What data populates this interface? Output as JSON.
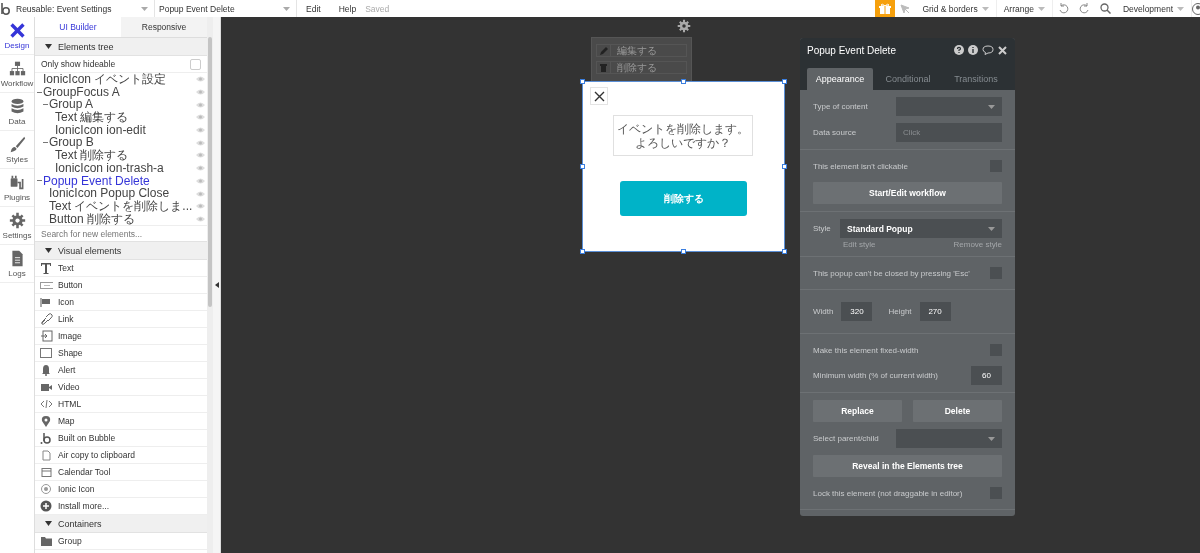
{
  "top_bar": {
    "page_dropdown": "Reusable: Event Settings",
    "element_dropdown": "Popup Event Delete",
    "menus": [
      "Edit",
      "Help"
    ],
    "save_status": "Saved",
    "view_menus": [
      "Grid & borders",
      "Arrange"
    ],
    "environment": "Development"
  },
  "nav": [
    {
      "label": "Design",
      "selected": true
    },
    {
      "label": "Workflow",
      "selected": false
    },
    {
      "label": "Data",
      "selected": false
    },
    {
      "label": "Styles",
      "selected": false
    },
    {
      "label": "Plugins",
      "selected": false
    },
    {
      "label": "Settings",
      "selected": false
    },
    {
      "label": "Logs",
      "selected": false
    }
  ],
  "sidebar": {
    "tabs": [
      {
        "label": "UI Builder",
        "selected": true
      },
      {
        "label": "Responsive",
        "selected": false
      }
    ],
    "tree_header": "Elements tree",
    "hideable": {
      "label": "Only show hideable",
      "checked": false
    },
    "tree": [
      {
        "label": "IonicIcon イベント設定",
        "selected": false
      },
      {
        "label": "GroupFocus A",
        "selected": false,
        "children": [
          {
            "label": "Group A",
            "selected": false,
            "children": [
              {
                "label": "Text 編集する",
                "selected": false
              },
              {
                "label": "IonicIcon ion-edit",
                "selected": false
              }
            ]
          },
          {
            "label": "Group B",
            "selected": false,
            "children": [
              {
                "label": "Text 削除する",
                "selected": false
              },
              {
                "label": "IonicIcon ion-trash-a",
                "selected": false
              }
            ]
          }
        ]
      },
      {
        "label": "Popup Event Delete",
        "selected": true,
        "children": [
          {
            "label": "IonicIcon Popup Close",
            "selected": false
          },
          {
            "label": "Text イベントを削除しま...",
            "selected": false
          },
          {
            "label": "Button 削除する",
            "selected": false
          }
        ]
      }
    ],
    "search": {
      "placeholder": "Search for new elements..."
    },
    "visual_header": "Visual elements",
    "visual_items": [
      "Text",
      "Button",
      "Icon",
      "Link",
      "Image",
      "Shape",
      "Alert",
      "Video",
      "HTML",
      "Map",
      "Built on Bubble",
      "Air copy to clipboard",
      "Calendar Tool",
      "Ionic Icon",
      "Install more..."
    ],
    "containers_header": "Containers",
    "container_items": [
      "Group"
    ]
  },
  "canvas": {
    "group_menu": [
      "編集する",
      "削除する"
    ],
    "popup": {
      "message_lines": [
        "イベントを削除します。",
        "よろしいですか？"
      ],
      "button": "削除する"
    },
    "property_editor": {
      "title": "Popup Event Delete",
      "tabs": [
        {
          "label": "Appearance",
          "selected": true
        },
        {
          "label": "Conditional",
          "selected": false
        },
        {
          "label": "Transitions",
          "selected": false
        }
      ],
      "sections": [
        [
          {
            "kind": "dropdown",
            "label": "Type of content"
          },
          {
            "kind": "input",
            "label": "Data source",
            "placeholder": "Click"
          }
        ],
        [
          {
            "kind": "checkbox",
            "label": "This element isn't clickable",
            "checked": false
          },
          {
            "kind": "button",
            "label": "Start/Edit workflow"
          }
        ],
        [
          {
            "kind": "style",
            "label": "Style",
            "value": "Standard Popup",
            "links": [
              "Edit style",
              "Remove style"
            ]
          }
        ],
        [
          {
            "kind": "checkbox",
            "label": "This popup can't be closed by pressing 'Esc'",
            "checked": false
          }
        ],
        [
          {
            "kind": "size",
            "fields": [
              {
                "label": "Width",
                "value": "320"
              },
              {
                "label": "Height",
                "value": "270"
              }
            ]
          }
        ],
        [
          {
            "kind": "checkbox",
            "label": "Make this element fixed-width",
            "checked": false
          },
          {
            "kind": "number",
            "label": "Minimum width (% of current width)",
            "value": "60"
          }
        ],
        [
          {
            "kind": "button_pair",
            "buttons": [
              "Replace",
              "Delete"
            ]
          },
          {
            "kind": "dropdown",
            "label": "Select parent/child"
          },
          {
            "kind": "button",
            "label": "Reveal in the Elements tree"
          },
          {
            "kind": "checkbox",
            "label": "Lock this element (not draggable in editor)",
            "checked": false
          }
        ]
      ]
    }
  }
}
